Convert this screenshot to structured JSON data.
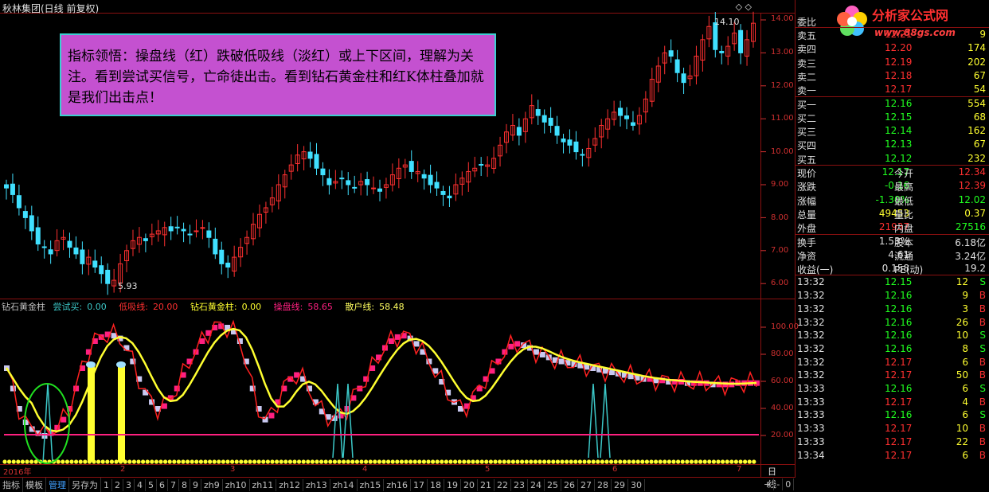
{
  "window": {
    "title": "秋林集团(日线 前复权)",
    "top_buttons": "◇ ◇"
  },
  "logo": {
    "name": "分析家公式网",
    "url": "www.88gs.com"
  },
  "annotation": {
    "text": "指标领悟：操盘线（红）跌破低吸线（淡红）或上下区间，理解为关注。看到尝试买信号，亡命徒出击。看到钻石黄金柱和红K体柱叠加就是我们出击点！"
  },
  "price_chart": {
    "high_label": "14.10",
    "low_label": "5.93",
    "y_labels": [
      "14.00",
      "13.00",
      "12.00",
      "11.00",
      "10.00",
      "9.00",
      "8.00",
      "7.00",
      "6.00"
    ]
  },
  "indicator": {
    "name": "钻石黄金柱",
    "items": [
      {
        "label": "尝试买:",
        "value": "0.00",
        "color": "#3cc8c8"
      },
      {
        "label": "低吸线:",
        "value": "20.00",
        "color": "#ff3030"
      },
      {
        "label": "钻石黄金柱:",
        "value": "0.00",
        "color": "#ffff30"
      },
      {
        "label": "操盘线:",
        "value": "58.65",
        "color": "#ff2080"
      },
      {
        "label": "散户线:",
        "value": "58.48",
        "color": "#ffff60"
      }
    ],
    "y_labels": [
      "100.00",
      "80.00",
      "60.00",
      "40.00",
      "20.00"
    ]
  },
  "time_axis": {
    "labels": [
      "2016年",
      "2",
      "3",
      "4",
      "5",
      "6",
      "7"
    ],
    "right_label": "日线"
  },
  "tabs": [
    "指标",
    "模板",
    "管理",
    "另存为",
    "1",
    "2",
    "3",
    "4",
    "5",
    "6",
    "7",
    "8",
    "9",
    "zh9",
    "zh10",
    "zh11",
    "zh12",
    "zh13",
    "zh14",
    "zh15",
    "zh16",
    "17",
    "18",
    "19",
    "20",
    "21",
    "22",
    "23",
    "24",
    "25",
    "26",
    "27",
    "28",
    "29",
    "30"
  ],
  "active_tab": "管理",
  "corner_buttons": [
    "+",
    "-",
    "0"
  ],
  "quote": {
    "weibi_label": "委比",
    "asks": [
      {
        "label": "卖五",
        "price": "12.21",
        "vol": "9"
      },
      {
        "label": "卖四",
        "price": "12.20",
        "vol": "174"
      },
      {
        "label": "卖三",
        "price": "12.19",
        "vol": "202"
      },
      {
        "label": "卖二",
        "price": "12.18",
        "vol": "67"
      },
      {
        "label": "卖一",
        "price": "12.17",
        "vol": "54"
      }
    ],
    "bids": [
      {
        "label": "买一",
        "price": "12.16",
        "vol": "554"
      },
      {
        "label": "买二",
        "price": "12.15",
        "vol": "68"
      },
      {
        "label": "买三",
        "price": "12.14",
        "vol": "162"
      },
      {
        "label": "买四",
        "price": "12.13",
        "vol": "67"
      },
      {
        "label": "买五",
        "price": "12.12",
        "vol": "232"
      }
    ],
    "stats": [
      {
        "l1": "现价",
        "v1": "12.17",
        "c1": "#20ff20",
        "l2": "今开",
        "v2": "12.34",
        "c2": "#ff3030"
      },
      {
        "l1": "涨跌",
        "v1": "-0.16",
        "c1": "#20ff20",
        "l2": "最高",
        "v2": "12.39",
        "c2": "#ff3030"
      },
      {
        "l1": "涨幅",
        "v1": "-1.30%",
        "c1": "#20ff20",
        "l2": "最低",
        "v2": "12.02",
        "c2": "#20ff20"
      },
      {
        "l1": "总量",
        "v1": "49453",
        "c1": "#ffff30",
        "l2": "量比",
        "v2": "0.37",
        "c2": "#ffff30"
      },
      {
        "l1": "外盘",
        "v1": "21937",
        "c1": "#ff3030",
        "l2": "内盘",
        "v2": "27516",
        "c2": "#20ff20"
      }
    ],
    "fund": [
      {
        "l1": "换手",
        "v1": "1.53%",
        "l2": "股本",
        "v2": "6.18亿"
      },
      {
        "l1": "净资",
        "v1": "4.61",
        "l2": "流通",
        "v2": "3.24亿"
      },
      {
        "l1": "收益(一)",
        "v1": "0.158",
        "l2": "PE(动)",
        "v2": "19.2"
      }
    ],
    "ticks": [
      {
        "t": "13:32",
        "p": "12.15",
        "v": "12",
        "s": "S"
      },
      {
        "t": "13:32",
        "p": "12.16",
        "v": "9",
        "s": "B"
      },
      {
        "t": "13:32",
        "p": "12.16",
        "v": "3",
        "s": "B"
      },
      {
        "t": "13:32",
        "p": "12.16",
        "v": "26",
        "s": "B"
      },
      {
        "t": "13:32",
        "p": "12.16",
        "v": "10",
        "s": "S"
      },
      {
        "t": "13:32",
        "p": "12.16",
        "v": "8",
        "s": "S"
      },
      {
        "t": "13:32",
        "p": "12.17",
        "v": "6",
        "s": "B"
      },
      {
        "t": "13:32",
        "p": "12.17",
        "v": "50",
        "s": "B"
      },
      {
        "t": "13:33",
        "p": "12.16",
        "v": "6",
        "s": "S"
      },
      {
        "t": "13:33",
        "p": "12.17",
        "v": "4",
        "s": "B"
      },
      {
        "t": "13:33",
        "p": "12.16",
        "v": "6",
        "s": "S"
      },
      {
        "t": "13:33",
        "p": "12.17",
        "v": "10",
        "s": "B"
      },
      {
        "t": "13:33",
        "p": "12.17",
        "v": "22",
        "s": "B"
      },
      {
        "t": "13:34",
        "p": "12.17",
        "v": "6",
        "s": "B"
      }
    ]
  },
  "colors": {
    "up": "#ff3030",
    "down": "#40e0ff",
    "grid": "#8a1010",
    "pink": "#ff2080",
    "lavender": "#c8c8f0",
    "yellow": "#ffff30",
    "cyan": "#3cc8c8"
  }
}
